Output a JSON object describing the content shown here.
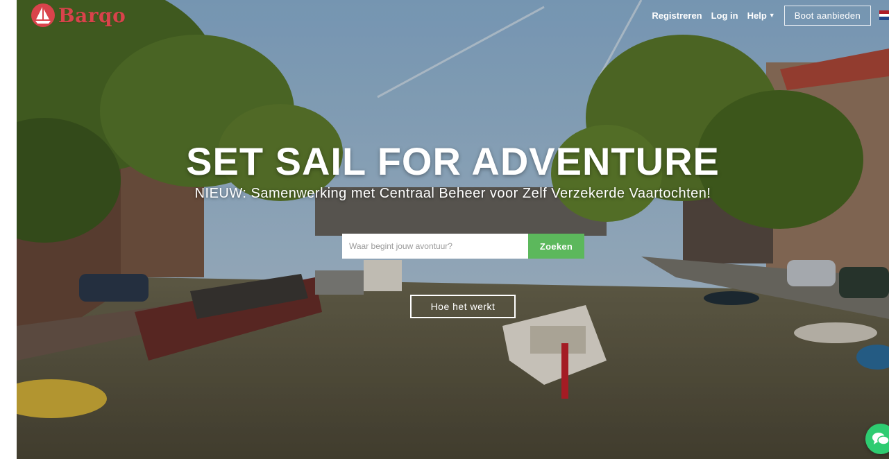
{
  "brand": {
    "name": "Barqo",
    "color": "#d9434b"
  },
  "nav": {
    "register": "Registreren",
    "login": "Log in",
    "help": "Help",
    "offer_boat": "Boot aanbieden",
    "language_flag": "dutch-flag-icon"
  },
  "hero": {
    "title": "SET SAIL FOR ADVENTURE",
    "subtitle": "NIEUW: Samenwerking met Centraal Beheer voor Zelf Verzekerde Vaartochten!"
  },
  "search": {
    "placeholder": "Waar begint jouw avontuur?",
    "button": "Zoeken",
    "button_color": "#5cb85c"
  },
  "how_it_works": "Hoe het werkt",
  "chat": {
    "icon": "chat-bubbles-icon",
    "color": "#2ecc71"
  }
}
